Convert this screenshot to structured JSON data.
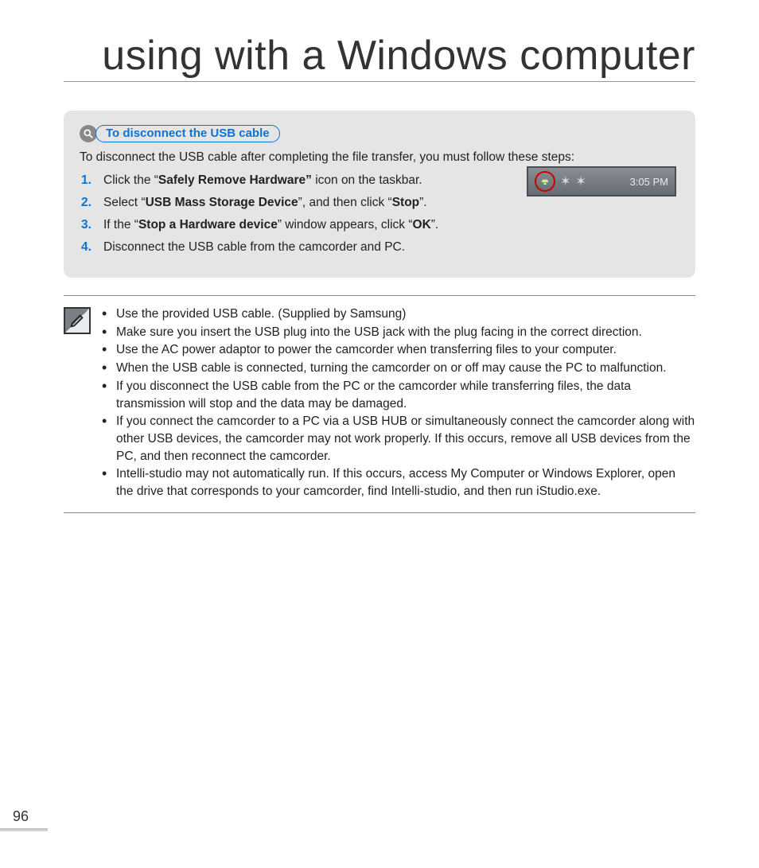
{
  "title": "using with a Windows computer",
  "callout": {
    "heading": "To disconnect the USB cable",
    "intro": "To disconnect the USB cable after completing the file transfer, you must follow these steps:",
    "steps": [
      {
        "pre": "Click the “",
        "bold": "Safely Remove Hardware”",
        "post": " icon on the taskbar."
      },
      {
        "pre": "Select “",
        "bold": "USB Mass Storage Device",
        "mid": "”, and then click “",
        "bold2": "Stop",
        "post": "”."
      },
      {
        "pre": "If the “",
        "bold": "Stop a Hardware device",
        "mid": "” window appears, click “",
        "bold2": "OK",
        "post": "”."
      },
      {
        "pre": "Disconnect the USB cable from the camcorder and PC.",
        "bold": "",
        "post": ""
      }
    ],
    "tray_time": "3:05 PM"
  },
  "notes": [
    "Use the provided USB cable. (Supplied by Samsung)",
    "Make sure you insert the USB plug into the USB jack with the plug facing in the correct direction.",
    "Use the AC power adaptor to power the camcorder when transferring files to your computer.",
    "When the USB cable is connected, turning the camcorder on or off may cause the PC to malfunction.",
    "If you disconnect the USB cable from the PC or the camcorder while transferring files, the data transmission will stop and the data may be damaged.",
    "If you connect the camcorder to a PC via a USB HUB or simultaneously connect the camcorder along with other USB devices, the camcorder may not work properly. If this occurs, remove all USB devices from the PC, and then reconnect the camcorder.",
    "Intelli-studio may not automatically run. If this occurs, access My Computer or Windows Explorer, open the drive that corresponds to your camcorder, find Intelli-studio, and then run iStudio.exe."
  ],
  "page_number": "96"
}
